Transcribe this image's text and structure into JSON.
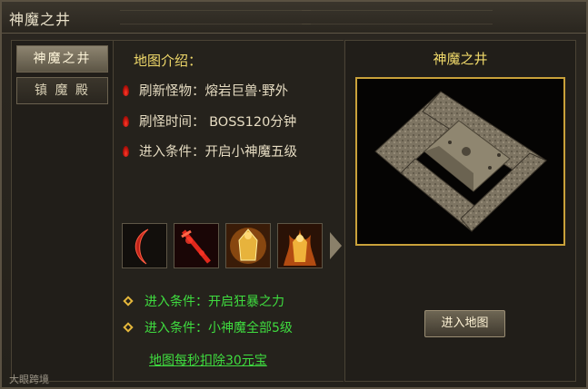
{
  "window": {
    "title": "神魔之井"
  },
  "sidebar": {
    "tabs": [
      {
        "label": "神魔之井",
        "active": true
      },
      {
        "label": "镇 魔 殿",
        "active": false
      }
    ]
  },
  "info": {
    "heading": "地图介绍：",
    "monster": "刷新怪物：熔岩巨兽·野外",
    "spawn_time": "刷怪时间： BOSS120分钟",
    "entry_condition": "进入条件：开启小神魔五级"
  },
  "items": [
    {
      "icon": "curved-blade-icon"
    },
    {
      "icon": "red-sword-icon"
    },
    {
      "icon": "golden-armor-icon"
    },
    {
      "icon": "flame-warrior-icon"
    }
  ],
  "conditions": [
    "进入条件：开启狂暴之力",
    "进入条件：小神魔全部5级"
  ],
  "cost_text": "地图每秒扣除30元宝",
  "map": {
    "title": "神魔之井",
    "enter_button": "进入地图"
  },
  "watermark": "大眼跨境",
  "colors": {
    "gold_text": "#f0d96a",
    "green_text": "#3fdc3f",
    "map_border": "#c9a13a"
  }
}
